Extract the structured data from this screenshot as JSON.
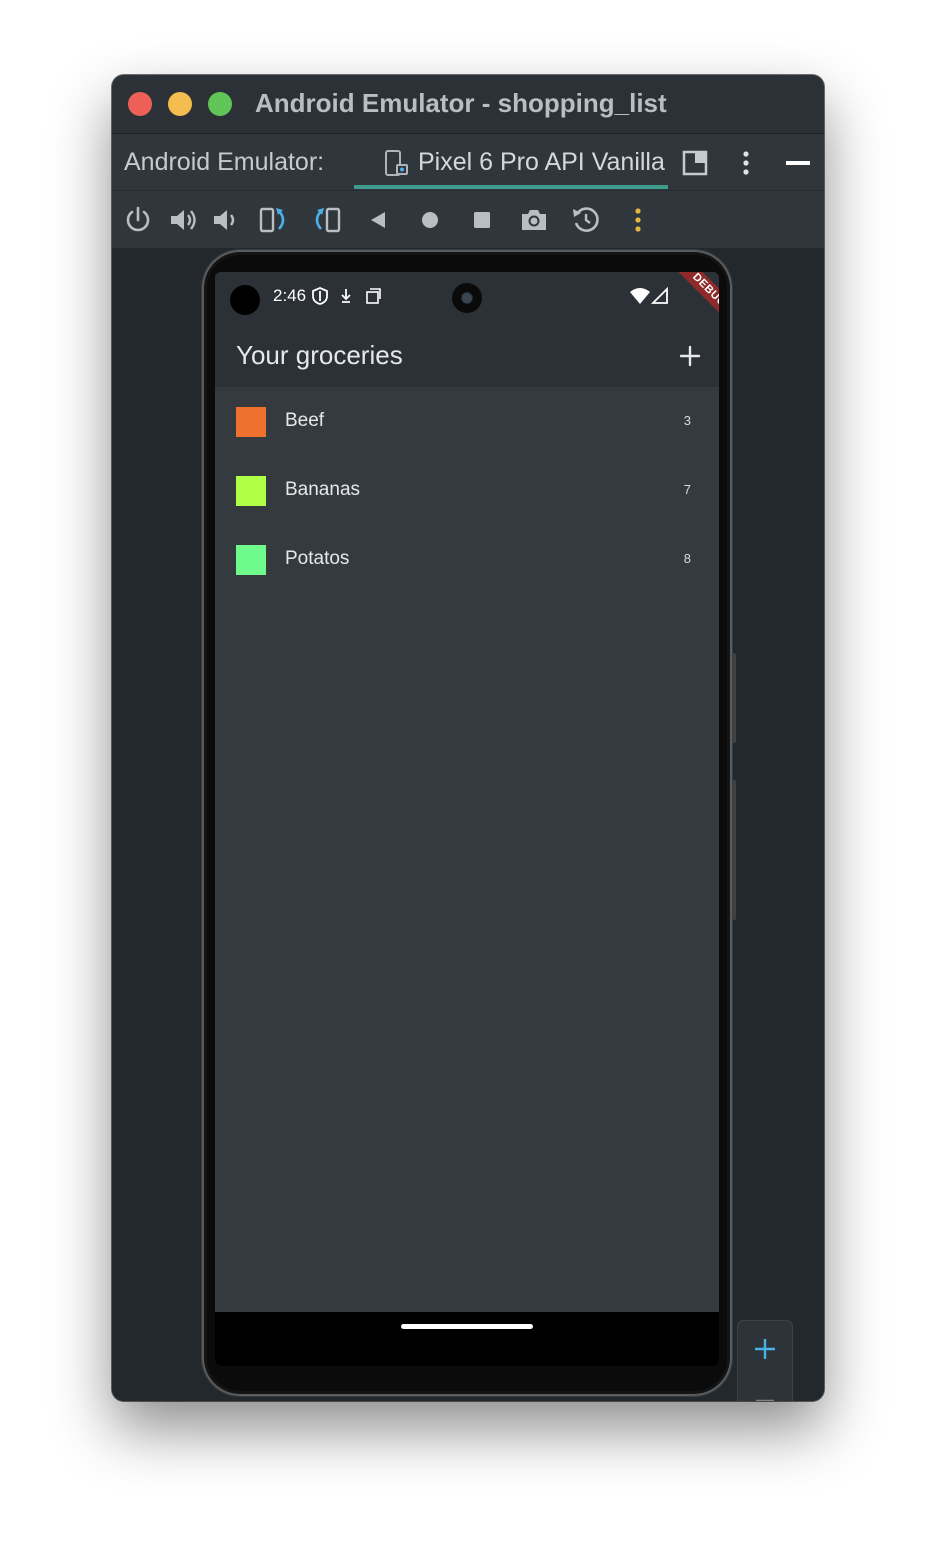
{
  "window": {
    "title": "Android Emulator - shopping_list"
  },
  "tabs": {
    "prefix": "Android Emulator:",
    "device_label": "Pixel 6 Pro API Vanilla"
  },
  "toolbar": {
    "icons": [
      "power-icon",
      "volume-up-icon",
      "volume-down-icon",
      "rotate-left-icon",
      "rotate-right-icon",
      "back-icon",
      "home-icon",
      "overview-icon",
      "screenshot-icon",
      "snapshot-icon",
      "more-icon"
    ]
  },
  "statusbar": {
    "time": "2:46"
  },
  "debug_banner": "DEBUG",
  "appbar": {
    "title": "Your groceries"
  },
  "groceries": [
    {
      "name": "Beef",
      "quantity": "3",
      "color": "#f07030"
    },
    {
      "name": "Bananas",
      "quantity": "7",
      "color": "#aeff45"
    },
    {
      "name": "Potatos",
      "quantity": "8",
      "color": "#6ffa8c"
    }
  ],
  "colors": {
    "window_bg": "#22282c",
    "appbar_bg": "#2b3137",
    "screen_bg": "#343a3e",
    "tab_accent": "#3f9c8c",
    "zoom_accent": "#4ab0e6"
  }
}
